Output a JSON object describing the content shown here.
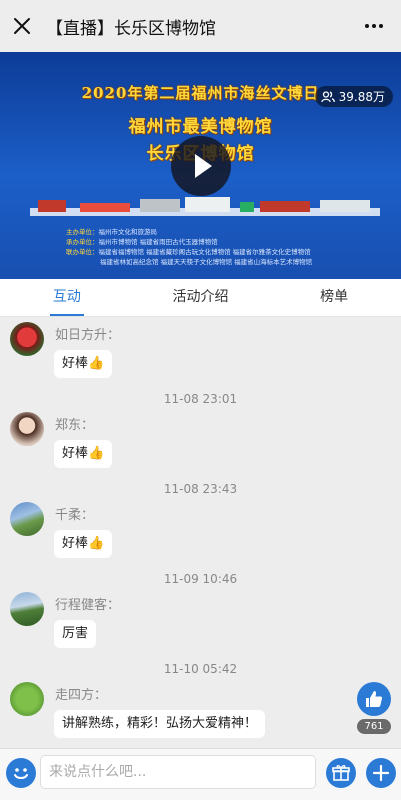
{
  "header": {
    "title": "【直播】长乐区博物馆",
    "close_icon": "close-icon",
    "more_icon": "more-dots-icon"
  },
  "banner": {
    "line1": "2020年第二届福州市海丝文博日",
    "line2": "福州市最美博物馆",
    "line3": "长乐区博物馆",
    "viewers": "39.88万",
    "organizers": [
      {
        "k": "主办单位：",
        "v": "福州市文化和旅游局"
      },
      {
        "k": "承办单位：",
        "v": "福州市博物馆  福建省雨田古代玉器博物馆"
      },
      {
        "k": "联办单位：",
        "v": "福建省福博物馆  福建省藏珍阁古玩文化博物馆  福建省尔雅茶文化史博物馆"
      },
      {
        "k": "",
        "v": "福建省林如高纪念馆  福建天天筷子文化博物馆  福建省山海标本艺术博物馆"
      }
    ]
  },
  "tabs": [
    {
      "label": "互动",
      "active": true
    },
    {
      "label": "活动介绍",
      "active": false
    },
    {
      "label": "榜单",
      "active": false
    }
  ],
  "messages": [
    {
      "name": "如日方升：",
      "text": "好棒👍",
      "time": "11-08 23:01"
    },
    {
      "name": "郑东：",
      "text": "好棒👍",
      "time": "11-08 23:43"
    },
    {
      "name": "千柔：",
      "text": "好棒👍",
      "time": "11-09 10:46"
    },
    {
      "name": "行程健客：",
      "text": "厉害",
      "time": "11-10 05:42"
    },
    {
      "name": "走四方：",
      "text": "讲解熟练，精彩！弘扬大爱精神！",
      "time": ""
    }
  ],
  "like": {
    "count": "761"
  },
  "input": {
    "placeholder": "来说点什么吧..."
  },
  "colors": {
    "accent": "#2a7ad6",
    "banner": "#1c5fc8",
    "title_gold": "#ffd83a"
  }
}
